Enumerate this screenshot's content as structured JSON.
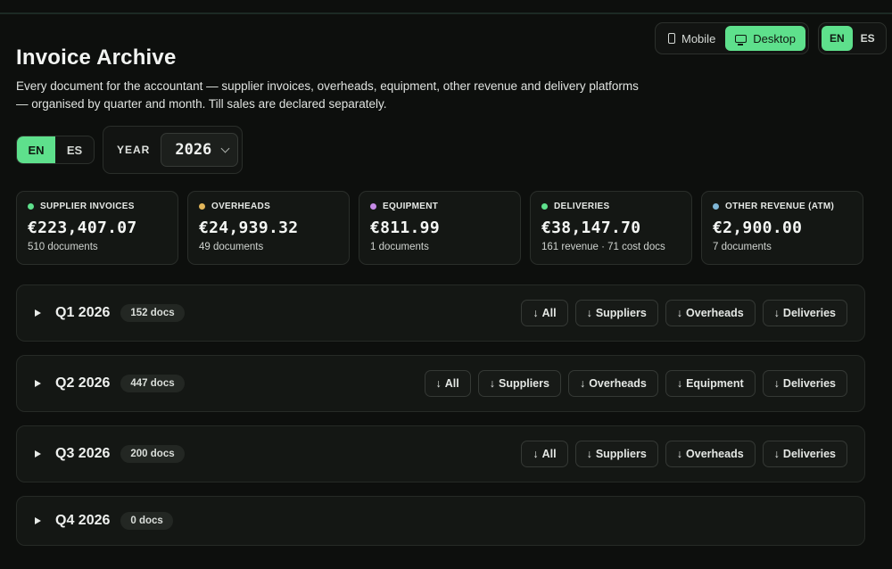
{
  "view_toggle": {
    "mobile_label": "Mobile",
    "desktop_label": "Desktop",
    "active": "Desktop"
  },
  "top_lang": {
    "en": "EN",
    "es": "ES",
    "active": "EN"
  },
  "header": {
    "title": "Invoice Archive",
    "subtitle": "Every document for the accountant — supplier invoices, overheads, equipment, other revenue and delivery platforms — organised by quarter and month. Till sales are declared separately."
  },
  "lang": {
    "en": "EN",
    "es": "ES",
    "active": "EN"
  },
  "year": {
    "label": "YEAR",
    "value": "2026"
  },
  "accent_color": "#5ee08c",
  "cards": [
    {
      "label": "SUPPLIER INVOICES",
      "amount": "€223,407.07",
      "sub": "510 documents",
      "color": "#5ee08c"
    },
    {
      "label": "OVERHEADS",
      "amount": "€24,939.32",
      "sub": "49 documents",
      "color": "#e2b65a"
    },
    {
      "label": "EQUIPMENT",
      "amount": "€811.99",
      "sub": "1 documents",
      "color": "#c58ae6"
    },
    {
      "label": "DELIVERIES",
      "amount": "€38,147.70",
      "sub": "161 revenue · 71 cost docs",
      "color": "#5ee08c"
    },
    {
      "label": "OTHER REVENUE (ATM)",
      "amount": "€2,900.00",
      "sub": "7 documents",
      "color": "#7fb6d6"
    }
  ],
  "quarters": [
    {
      "title": "Q1 2026",
      "badge": "152 docs",
      "actions": [
        "All",
        "Suppliers",
        "Overheads",
        "Deliveries"
      ]
    },
    {
      "title": "Q2 2026",
      "badge": "447 docs",
      "actions": [
        "All",
        "Suppliers",
        "Overheads",
        "Equipment",
        "Deliveries"
      ]
    },
    {
      "title": "Q3 2026",
      "badge": "200 docs",
      "actions": [
        "All",
        "Suppliers",
        "Overheads",
        "Deliveries"
      ]
    },
    {
      "title": "Q4 2026",
      "badge": "0 docs",
      "actions": []
    }
  ],
  "icons": {
    "mobile": "phone-icon",
    "desktop": "monitor-icon",
    "download": "arrow-down-icon",
    "expand": "triangle-right-icon",
    "select": "chevron-down-icon"
  }
}
